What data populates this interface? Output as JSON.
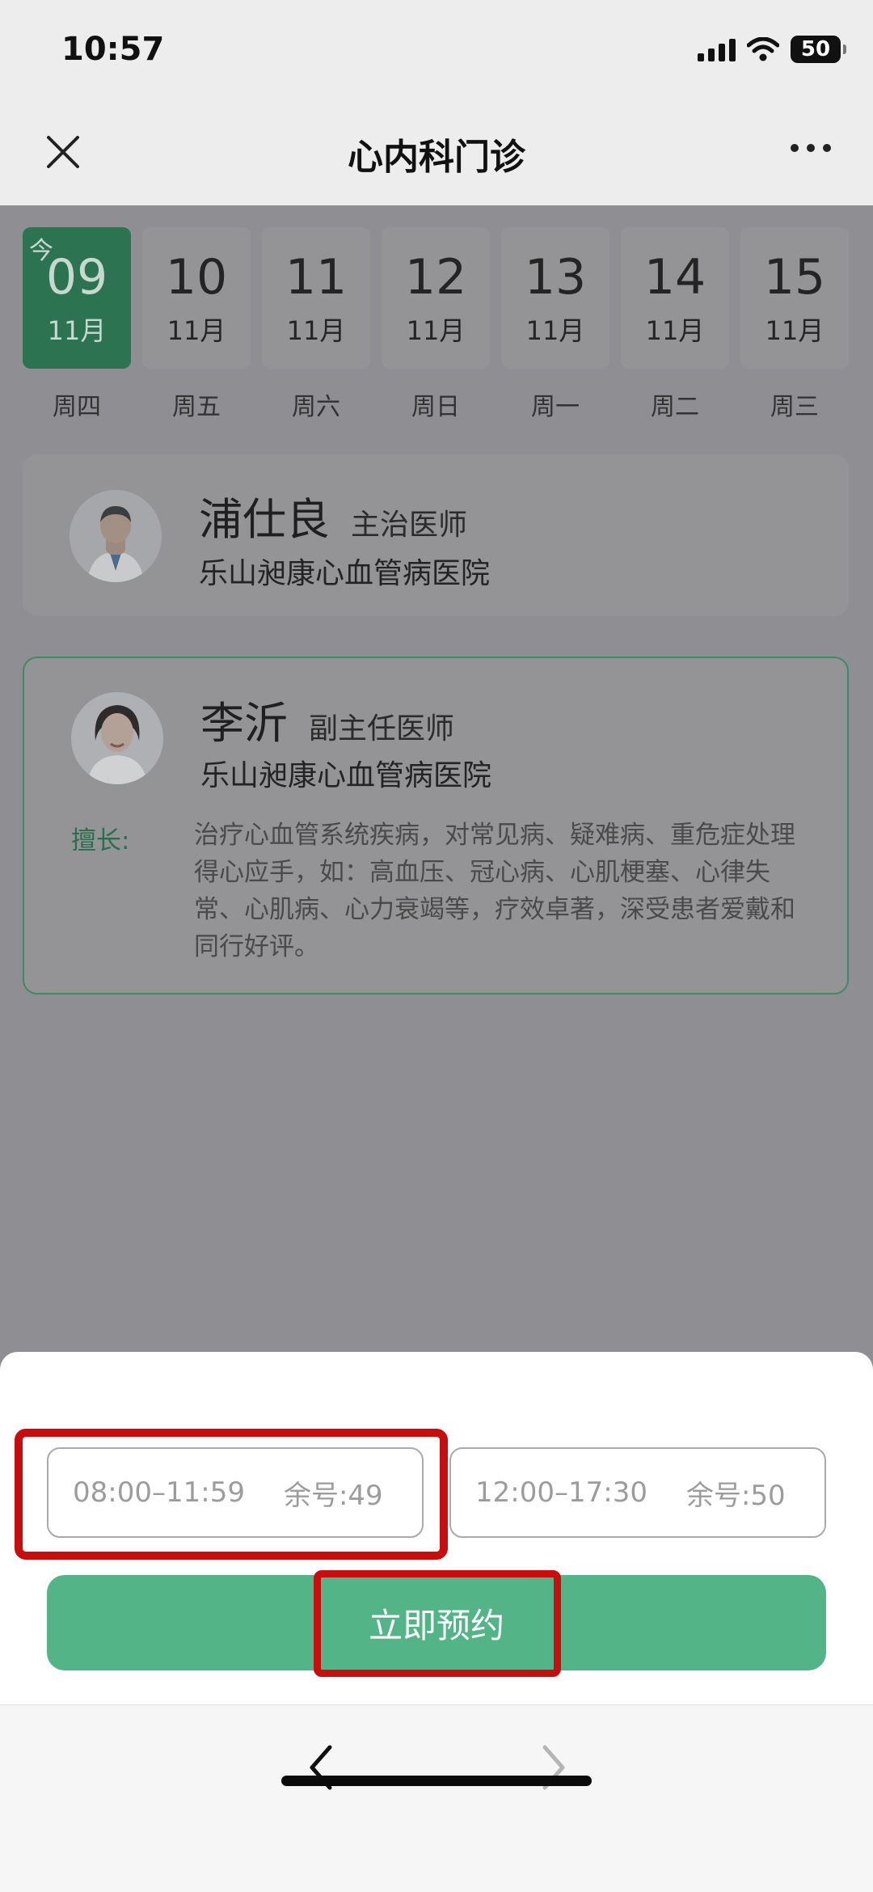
{
  "status_bar": {
    "time": "10:57",
    "battery": "50"
  },
  "nav": {
    "title": "心内科门诊"
  },
  "dates": [
    {
      "day": "09",
      "month": "11月",
      "weekday": "周四",
      "today_mark": "今",
      "active": true
    },
    {
      "day": "10",
      "month": "11月",
      "weekday": "周五"
    },
    {
      "day": "11",
      "month": "11月",
      "weekday": "周六"
    },
    {
      "day": "12",
      "month": "11月",
      "weekday": "周日"
    },
    {
      "day": "13",
      "month": "11月",
      "weekday": "周一"
    },
    {
      "day": "14",
      "month": "11月",
      "weekday": "周二"
    },
    {
      "day": "15",
      "month": "11月",
      "weekday": "周三"
    }
  ],
  "doctors": [
    {
      "name": "浦仕良",
      "title": "主治医师",
      "hospital": "乐山昶康心血管病医院"
    },
    {
      "name": "李沂",
      "title": "副主任医师",
      "hospital": "乐山昶康心血管病医院",
      "specialty_label": "擅长:",
      "specialty": "治疗心血管系统疾病，对常见病、疑难病、重危症处理得心应手，如：高血压、冠心病、心肌梗塞、心律失常、心肌病、心力衰竭等，疗效卓著，深受患者爱戴和同行好评。"
    }
  ],
  "slots": [
    {
      "time": "08:00–11:59",
      "remaining": "余号:49"
    },
    {
      "time": "12:00–17:30",
      "remaining": "余号:50"
    }
  ],
  "book_button": "立即预约",
  "colors": {
    "accent": "#53b487",
    "active_date": "#2c7352",
    "highlight": "#c70d0d"
  }
}
